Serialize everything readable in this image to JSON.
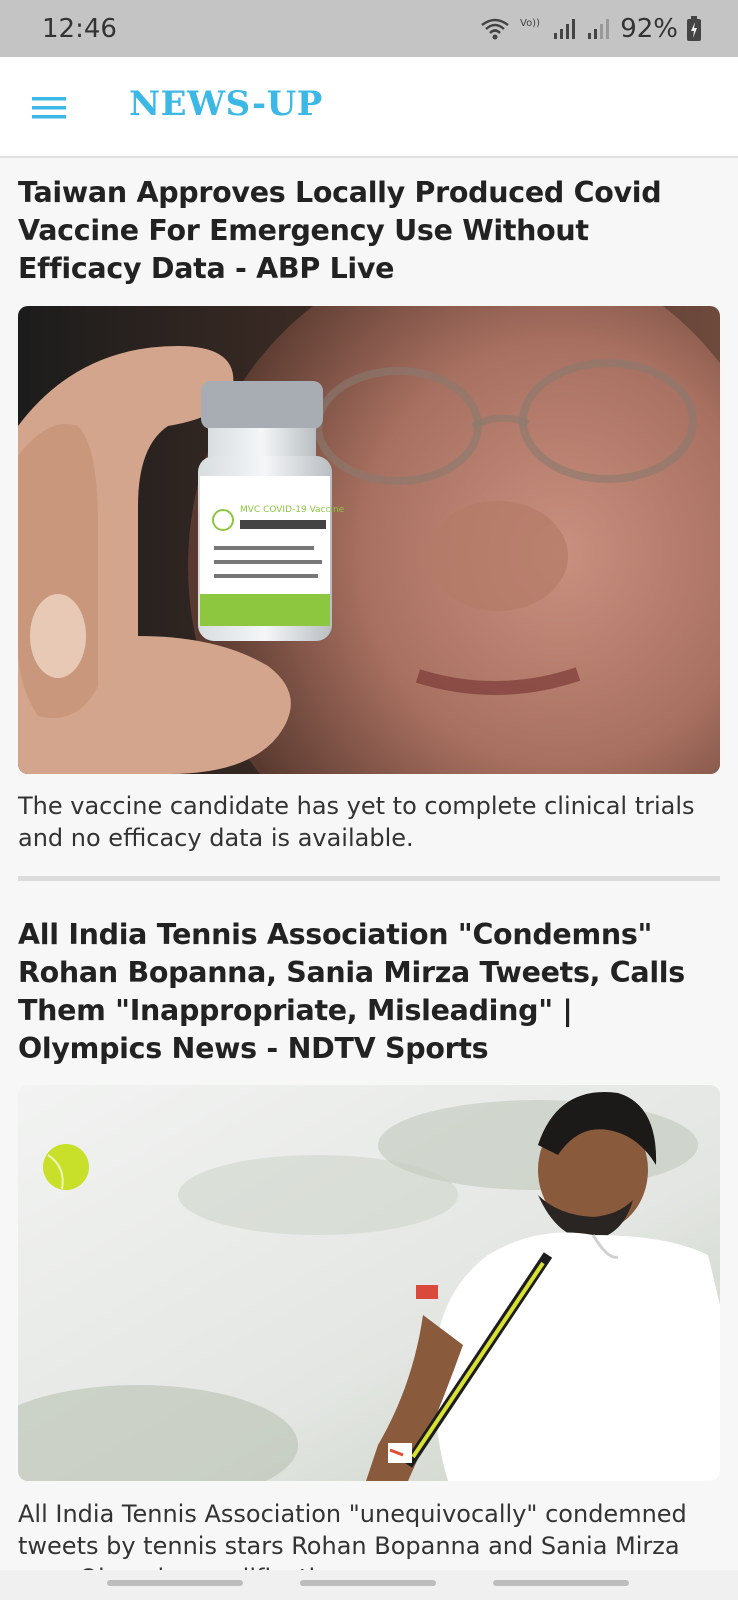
{
  "status_bar": {
    "time": "12:46",
    "battery": "92%",
    "icons": [
      "wifi-icon",
      "volte-lte-icon",
      "signal-icon",
      "signal-icon",
      "battery-charging-icon"
    ],
    "volte_label": "Vo)) LTE1"
  },
  "app_bar": {
    "title": "NEWS-UP",
    "menu_icon": "hamburger-menu-icon",
    "accent": "#3bb8e6"
  },
  "articles": [
    {
      "title": "Taiwan Approves Locally Produced Covid Vaccine For Emergency Use Without Efficacy Data - ABP Live",
      "image_alt": "vaccine-vial-photo",
      "vial_label": "MVC COVID-19 Vaccine",
      "description": "The vaccine candidate has yet to complete clinical trials and no efficacy data is available."
    },
    {
      "title": "All India Tennis Association \"Condemns\" Rohan Bopanna, Sania Mirza Tweets, Calls Them \"Inappropriate, Misleading\" | Olympics News - NDTV Sports",
      "image_alt": "tennis-player-photo",
      "description": "All India Tennis Association \"unequivocally\" condemned tweets by tennis stars Rohan Bopanna and Sania Mirza over Olympics qualification"
    }
  ]
}
